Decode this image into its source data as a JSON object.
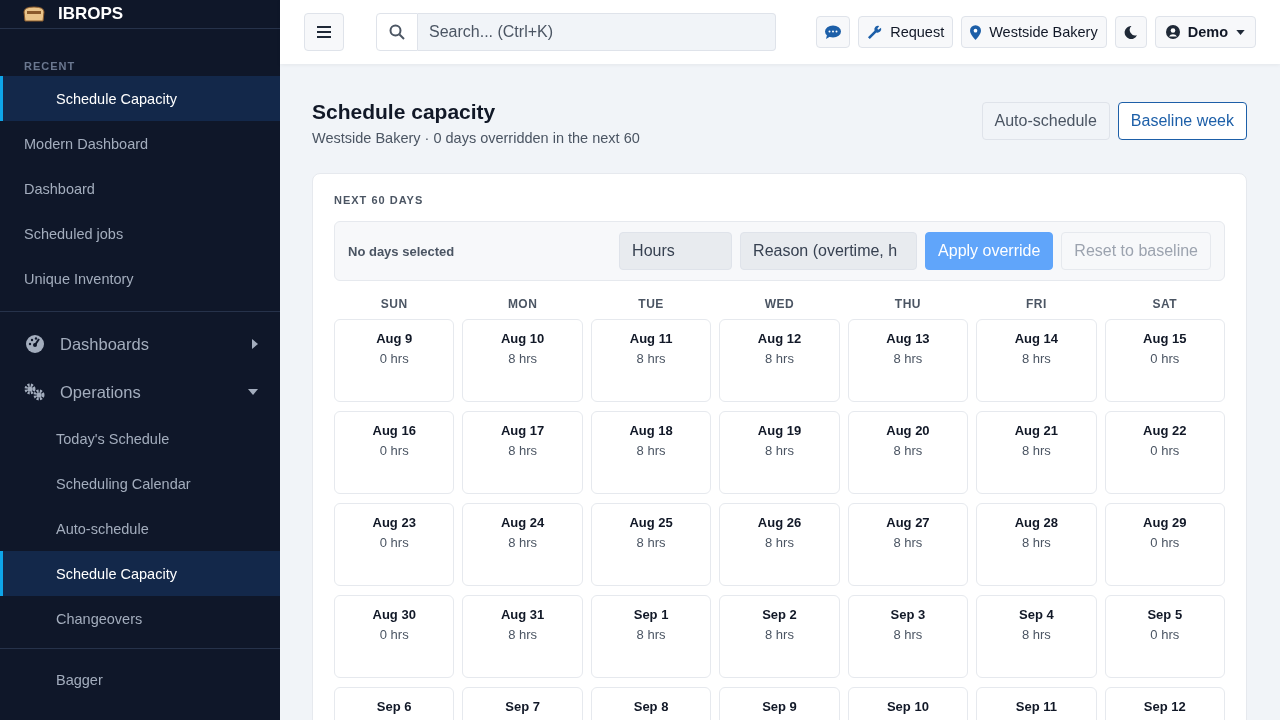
{
  "sidebar": {
    "brand": "IBROPS",
    "recent_label": "RECENT",
    "recent": [
      {
        "label": "Schedule Capacity",
        "selected": true
      }
    ],
    "items": [
      {
        "label": "Modern Dashboard",
        "selected": false
      },
      {
        "label": "Dashboard",
        "selected": false
      },
      {
        "label": "Scheduled jobs",
        "selected": false
      },
      {
        "label": "Unique Inventory",
        "selected": false
      }
    ],
    "groups": [
      {
        "label": "Dashboards",
        "expanded": false
      },
      {
        "label": "Operations",
        "expanded": true,
        "children": [
          {
            "label": "Today's Schedule",
            "selected": false
          },
          {
            "label": "Scheduling Calendar",
            "selected": false
          },
          {
            "label": "Auto-schedule",
            "selected": false
          },
          {
            "label": "Schedule Capacity",
            "selected": true
          },
          {
            "label": "Changeovers",
            "selected": false
          }
        ]
      }
    ],
    "footer_items": [
      {
        "label": "Bagger",
        "selected": false
      }
    ]
  },
  "topbar": {
    "search_placeholder": "Search... (Ctrl+K)",
    "request": "Request",
    "location": "Westside Bakery",
    "user": "Demo"
  },
  "page": {
    "title": "Schedule capacity",
    "subtitle": "Westside Bakery · 0 days overridden in the next 60",
    "actions": [
      {
        "label": "Auto-schedule",
        "kind": "plain"
      },
      {
        "label": "Baseline week",
        "kind": "outline"
      }
    ]
  },
  "card": {
    "label": "NEXT 60 DAYS",
    "status": "No days selected",
    "hours_placeholder": "Hours",
    "reason_placeholder": "Reason (overtime, h",
    "buttons": [
      {
        "label": "Apply override",
        "kind": "primary",
        "disabled": true
      },
      {
        "label": "Reset to baseline",
        "kind": "outline",
        "disabled": true
      }
    ],
    "weekdays": [
      "SUN",
      "MON",
      "TUE",
      "WED",
      "THU",
      "FRI",
      "SAT"
    ],
    "weeks": [
      [
        {
          "date": "Aug 9",
          "hours": "0 hrs"
        },
        {
          "date": "Aug 10",
          "hours": "8 hrs"
        },
        {
          "date": "Aug 11",
          "hours": "8 hrs"
        },
        {
          "date": "Aug 12",
          "hours": "8 hrs"
        },
        {
          "date": "Aug 13",
          "hours": "8 hrs"
        },
        {
          "date": "Aug 14",
          "hours": "8 hrs"
        },
        {
          "date": "Aug 15",
          "hours": "0 hrs"
        }
      ],
      [
        {
          "date": "Aug 16",
          "hours": "0 hrs"
        },
        {
          "date": "Aug 17",
          "hours": "8 hrs"
        },
        {
          "date": "Aug 18",
          "hours": "8 hrs"
        },
        {
          "date": "Aug 19",
          "hours": "8 hrs"
        },
        {
          "date": "Aug 20",
          "hours": "8 hrs"
        },
        {
          "date": "Aug 21",
          "hours": "8 hrs"
        },
        {
          "date": "Aug 22",
          "hours": "0 hrs"
        }
      ],
      [
        {
          "date": "Aug 23",
          "hours": "0 hrs"
        },
        {
          "date": "Aug 24",
          "hours": "8 hrs"
        },
        {
          "date": "Aug 25",
          "hours": "8 hrs"
        },
        {
          "date": "Aug 26",
          "hours": "8 hrs"
        },
        {
          "date": "Aug 27",
          "hours": "8 hrs"
        },
        {
          "date": "Aug 28",
          "hours": "8 hrs"
        },
        {
          "date": "Aug 29",
          "hours": "0 hrs"
        }
      ],
      [
        {
          "date": "Aug 30",
          "hours": "0 hrs"
        },
        {
          "date": "Aug 31",
          "hours": "8 hrs"
        },
        {
          "date": "Sep 1",
          "hours": "8 hrs"
        },
        {
          "date": "Sep 2",
          "hours": "8 hrs"
        },
        {
          "date": "Sep 3",
          "hours": "8 hrs"
        },
        {
          "date": "Sep 4",
          "hours": "8 hrs"
        },
        {
          "date": "Sep 5",
          "hours": "0 hrs"
        }
      ],
      [
        {
          "date": "Sep 6"
        },
        {
          "date": "Sep 7"
        },
        {
          "date": "Sep 8"
        },
        {
          "date": "Sep 9"
        },
        {
          "date": "Sep 10"
        },
        {
          "date": "Sep 11"
        },
        {
          "date": "Sep 12"
        }
      ]
    ]
  }
}
